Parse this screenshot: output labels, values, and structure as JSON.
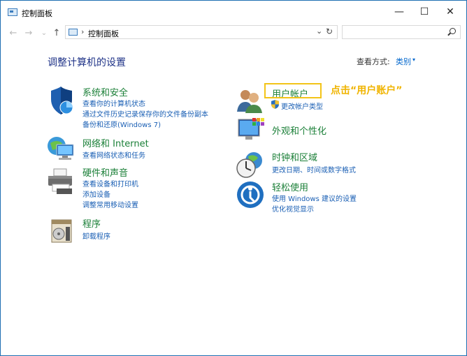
{
  "window": {
    "title": "控制面板",
    "minimize": "—",
    "maximize": "☐",
    "close": "✕"
  },
  "nav": {
    "back": "←",
    "forward": "→",
    "recent": "⌄",
    "up": "↑"
  },
  "address": {
    "separator": "›",
    "path": "控制面板",
    "dropdown": "⌄",
    "refresh": "↻"
  },
  "search": {
    "placeholder": ""
  },
  "heading": "调整计算机的设置",
  "view": {
    "label": "查看方式:",
    "value": "类别",
    "arrow": "▾"
  },
  "left": [
    {
      "title": "系统和安全",
      "links": [
        "查看你的计算机状态",
        "通过文件历史记录保存你的文件备份副本",
        "备份和还原(Windows 7)"
      ],
      "icon": "shield-icon"
    },
    {
      "title": "网络和 Internet",
      "links": [
        "查看网络状态和任务"
      ],
      "icon": "network-icon"
    },
    {
      "title": "硬件和声音",
      "links": [
        "查看设备和打印机",
        "添加设备",
        "调整常用移动设置"
      ],
      "icon": "printer-icon"
    },
    {
      "title": "程序",
      "links": [
        "卸载程序"
      ],
      "icon": "programs-icon"
    }
  ],
  "right": [
    {
      "title": "用户帐户",
      "links": [
        "更改帐户类型"
      ],
      "icon": "users-icon"
    },
    {
      "title": "外观和个性化",
      "links": [],
      "icon": "monitor-palette-icon"
    },
    {
      "title": "时钟和区域",
      "links": [
        "更改日期、时间或数字格式"
      ],
      "icon": "clock-globe-icon"
    },
    {
      "title": "轻松使用",
      "links": [
        "使用 Windows 建议的设置",
        "优化视觉显示"
      ],
      "icon": "ease-of-access-icon"
    }
  ],
  "annotation": "点击“用户账户”",
  "colors": {
    "title_green": "#1a7f37",
    "link_blue": "#1a5fb4",
    "highlight": "#f3c418",
    "annotation": "#f0b400",
    "heading": "#1e3287"
  }
}
